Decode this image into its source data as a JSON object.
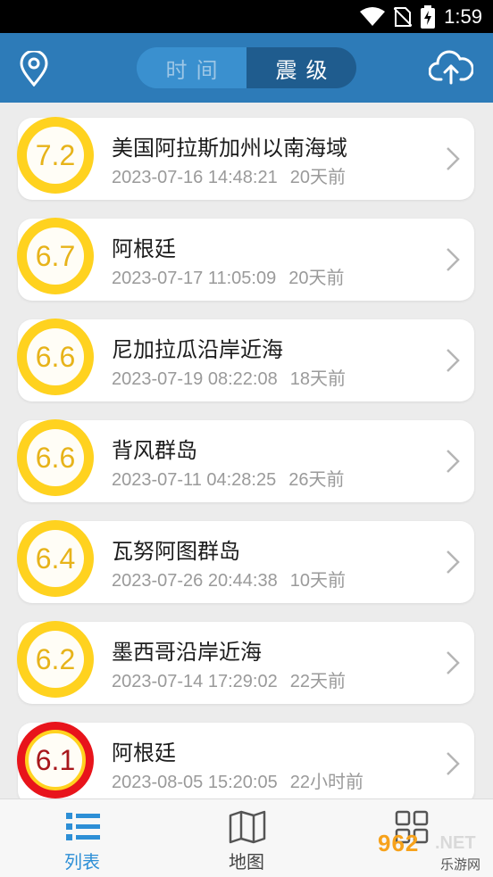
{
  "status_bar": {
    "time": "1:59"
  },
  "header": {
    "tabs": [
      {
        "label": "时间",
        "active": false
      },
      {
        "label": "震级",
        "active": true
      }
    ]
  },
  "earthquakes": [
    {
      "magnitude": "7.2",
      "place": "美国阿拉斯加州以南海域",
      "datetime": "2023-07-16 14:48:21",
      "ago": "20天前",
      "level": "yellow"
    },
    {
      "magnitude": "6.7",
      "place": "阿根廷",
      "datetime": "2023-07-17 11:05:09",
      "ago": "20天前",
      "level": "yellow"
    },
    {
      "magnitude": "6.6",
      "place": "尼加拉瓜沿岸近海",
      "datetime": "2023-07-19 08:22:08",
      "ago": "18天前",
      "level": "yellow"
    },
    {
      "magnitude": "6.6",
      "place": "背风群岛",
      "datetime": "2023-07-11 04:28:25",
      "ago": "26天前",
      "level": "yellow"
    },
    {
      "magnitude": "6.4",
      "place": "瓦努阿图群岛",
      "datetime": "2023-07-26 20:44:38",
      "ago": "10天前",
      "level": "yellow"
    },
    {
      "magnitude": "6.2",
      "place": "墨西哥沿岸近海",
      "datetime": "2023-07-14 17:29:02",
      "ago": "22天前",
      "level": "yellow"
    },
    {
      "magnitude": "6.1",
      "place": "阿根廷",
      "datetime": "2023-08-05 15:20:05",
      "ago": "22小时前",
      "level": "red"
    }
  ],
  "tabbar": {
    "items": [
      {
        "label": "列表",
        "icon": "list-icon",
        "active": true
      },
      {
        "label": "地图",
        "icon": "map-icon",
        "active": false
      },
      {
        "label": "",
        "icon": "grid-icon",
        "active": false
      }
    ]
  },
  "watermark": {
    "number": "962",
    "net": ".NET",
    "text": "乐游网"
  },
  "colors": {
    "header": "#2d7bb8",
    "accent": "#2d8fd6",
    "magnitude_yellow": "#ffd21f",
    "magnitude_red": "#e8141b"
  }
}
